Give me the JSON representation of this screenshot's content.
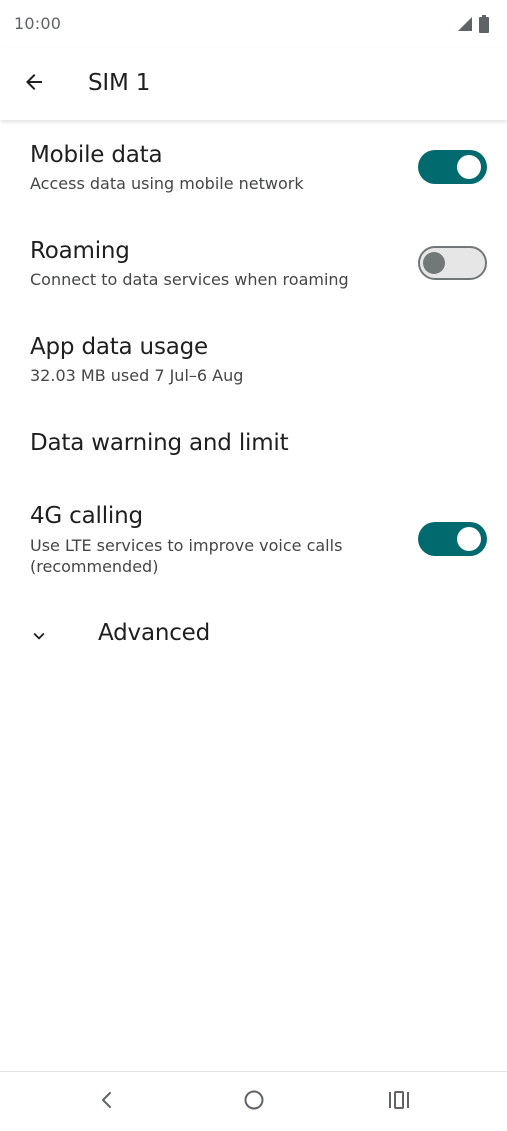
{
  "status_bar": {
    "time": "10:00",
    "icons": [
      "signal-icon",
      "battery-icon"
    ]
  },
  "app_bar": {
    "back_icon": "arrow-back-icon",
    "title": "SIM 1"
  },
  "settings": {
    "mobile_data": {
      "title": "Mobile data",
      "summary": "Access data using mobile network",
      "enabled": true
    },
    "roaming": {
      "title": "Roaming",
      "summary": "Connect to data services when roaming",
      "enabled": false
    },
    "app_data_usage": {
      "title": "App data usage",
      "summary": "32.03 MB used 7 Jul–6 Aug"
    },
    "data_warning": {
      "title": "Data warning and limit"
    },
    "calling_4g": {
      "title": "4G calling",
      "summary": "Use LTE services to improve voice calls (recommended)",
      "enabled": true
    },
    "advanced": {
      "label": "Advanced",
      "icon": "chevron-down-icon"
    }
  },
  "nav_bar": {
    "icons": [
      "back-nav-icon",
      "home-nav-icon",
      "recents-nav-icon"
    ]
  },
  "colors": {
    "accent": "#006a6f",
    "switch_off_track": "#e6e6e6",
    "switch_off_thumb": "#72787a",
    "text_primary": "#1f1f1f",
    "text_secondary": "#444746"
  }
}
